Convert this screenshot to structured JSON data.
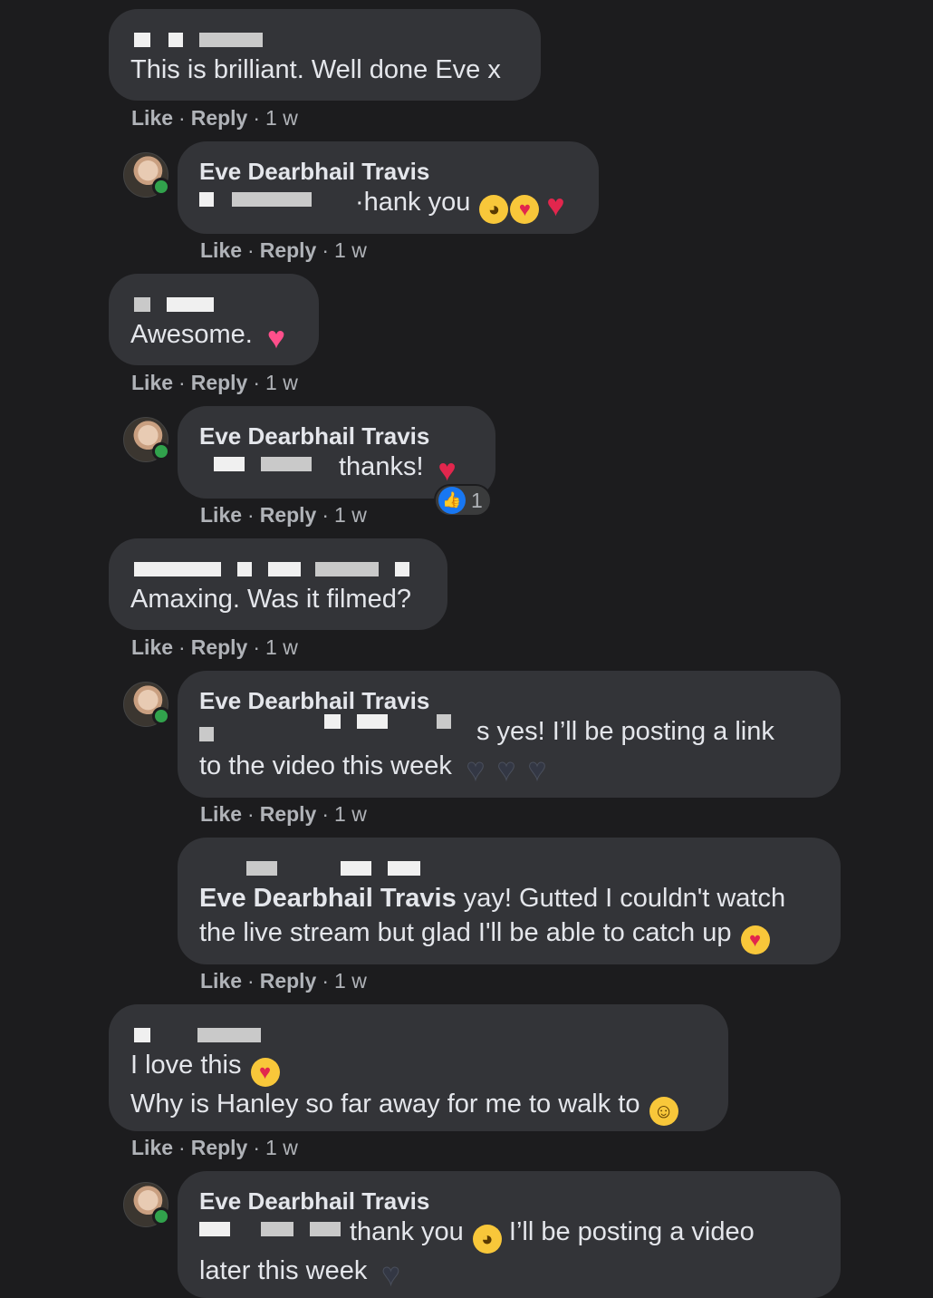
{
  "comments": [
    {
      "text": "This is brilliant. Well done Eve x",
      "meta": {
        "like": "Like",
        "reply": "Reply",
        "time": "1 w"
      }
    },
    {
      "author": "Eve Dearbhail Travis",
      "text": "·hank you",
      "meta": {
        "like": "Like",
        "reply": "Reply",
        "time": "1 w"
      }
    },
    {
      "text": "Awesome.",
      "meta": {
        "like": "Like",
        "reply": "Reply",
        "time": "1 w"
      }
    },
    {
      "author": "Eve Dearbhail Travis",
      "text": "thanks!",
      "reaction_count": "1",
      "meta": {
        "like": "Like",
        "reply": "Reply",
        "time": "1 w"
      }
    },
    {
      "text": "Amaxing. Was it filmed?",
      "meta": {
        "like": "Like",
        "reply": "Reply",
        "time": "1 w"
      }
    },
    {
      "author": "Eve Dearbhail Travis",
      "text_line1": "s yes! I’ll be posting a link",
      "text_line2": "to the video this week",
      "meta": {
        "like": "Like",
        "reply": "Reply",
        "time": "1 w"
      }
    },
    {
      "mention": "Eve Dearbhail Travis",
      "text_line1": " yay! Gutted I couldn't watch",
      "text_line2": "the live stream but glad I'll be able to catch up",
      "meta": {
        "like": "Like",
        "reply": "Reply",
        "time": "1 w"
      }
    },
    {
      "text_line1": "I love this",
      "text_line2": "Why is Hanley so far away for me to walk to",
      "meta": {
        "like": "Like",
        "reply": "Reply",
        "time": "1 w"
      }
    },
    {
      "author": "Eve Dearbhail Travis",
      "text_line1": "thank you",
      "text_line1b": "I’ll be posting a video",
      "text_line2": "later this week"
    }
  ],
  "icons": {
    "pleading": "pleading-face-emoji",
    "heart_eyes": "heart-eyes-emoji",
    "red_heart": "red-heart-emoji",
    "sparkling_heart": "sparkling-heart-emoji",
    "black_heart": "black-heart-emoji",
    "smiling_hearts": "smiling-face-with-hearts-emoji",
    "rofl": "rolling-on-floor-laughing-emoji",
    "like_reaction": "like-reaction-icon"
  },
  "colors": {
    "background": "#1c1c1e",
    "bubble": "#333438",
    "online": "#31a24c",
    "like_blue": "#1877f2"
  }
}
